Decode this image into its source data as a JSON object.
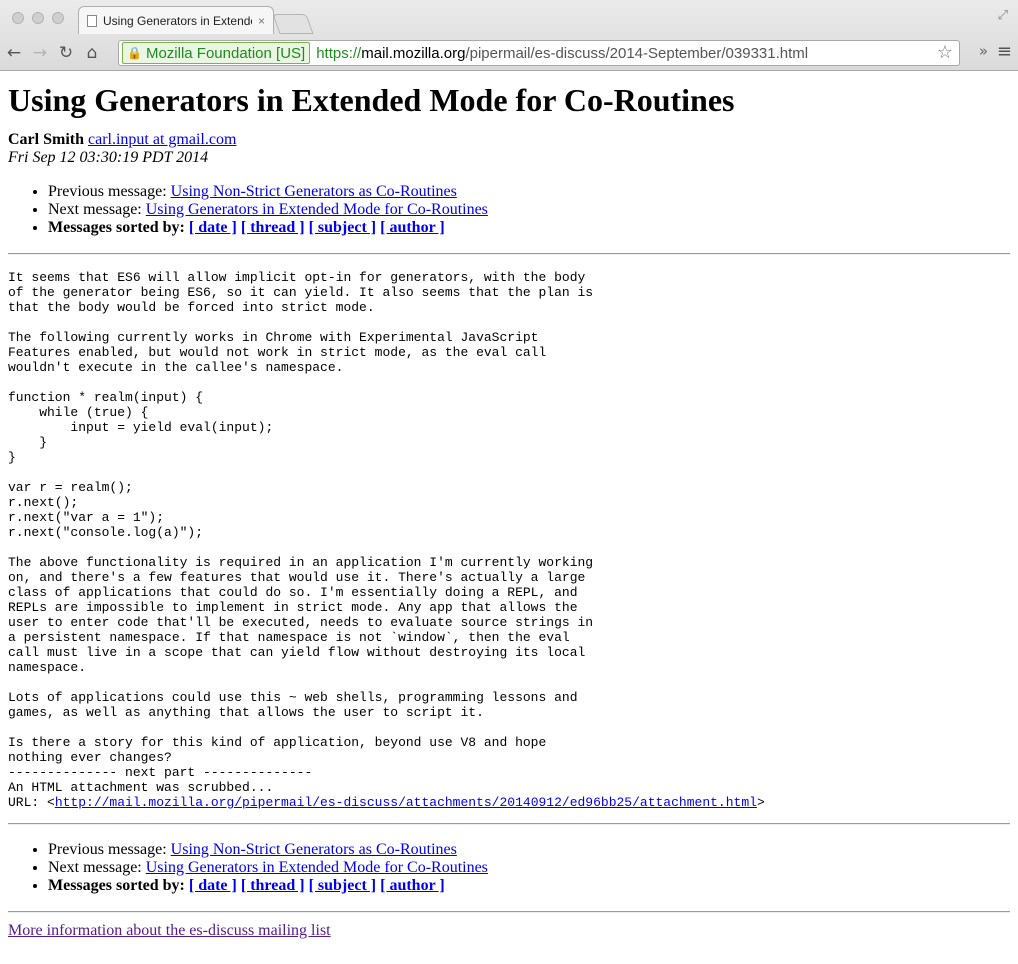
{
  "browser": {
    "tab_title": "Using Generators in Extende",
    "tab_close": "×",
    "ev_label": "Mozilla Foundation [US]",
    "url_scheme": "https://",
    "url_host": "mail.mozilla.org",
    "url_path": "/pipermail/es-discuss/2014-September/039331.html",
    "back": "←",
    "forward": "→",
    "reload": "↻",
    "home": "⌂",
    "star": "☆",
    "more": "»",
    "menu": "≡",
    "fullscreen": "⤢",
    "lock": "🔒"
  },
  "message": {
    "title": "Using Generators in Extended Mode for Co-Routines",
    "author": "Carl Smith",
    "email": "carl.input at gmail.com",
    "date": "Fri Sep 12 03:30:19 PDT 2014",
    "body": "It seems that ES6 will allow implicit opt-in for generators, with the body\nof the generator being ES6, so it can yield. It also seems that the plan is\nthat the body would be forced into strict mode.\n\nThe following currently works in Chrome with Experimental JavaScript\nFeatures enabled, but would not work in strict mode, as the eval call\nwouldn't execute in the callee's namespace.\n\nfunction * realm(input) {\n    while (true) {\n        input = yield eval(input);\n    }\n}\n\nvar r = realm();\nr.next();\nr.next(\"var a = 1\");\nr.next(\"console.log(a)\");\n\nThe above functionality is required in an application I'm currently working\non, and there's a few features that would use it. There's actually a large\nclass of applications that could do so. I'm essentially doing a REPL, and\nREPLs are impossible to implement in strict mode. Any app that allows the\nuser to enter code that'll be executed, needs to evaluate source strings in\na persistent namespace. If that namespace is not `window`, then the eval\ncall must live in a scope that can yield flow without destroying its local\nnamespace.\n\nLots of applications could use this ~ web shells, programming lessons and\ngames, as well as anything that allows the user to script it.\n\nIs there a story for this kind of application, beyond use V8 and hope\nnothing ever changes?\n-------------- next part --------------\nAn HTML attachment was scrubbed...",
    "attachment_prefix": "URL: <",
    "attachment_url": "http://mail.mozilla.org/pipermail/es-discuss/attachments/20140912/ed96bb25/attachment.html",
    "attachment_suffix": ">"
  },
  "nav": {
    "prev_label": "Previous message: ",
    "prev_link": "Using Non-Strict Generators as Co-Routines",
    "next_label": "Next message: ",
    "next_link": "Using Generators in Extended Mode for Co-Routines",
    "sorted_label": "Messages sorted by: ",
    "sort_date": "[ date ]",
    "sort_thread": "[ thread ]",
    "sort_subject": "[ subject ]",
    "sort_author": "[ author ]"
  },
  "footer": {
    "info_link": "More information about the es-discuss mailing list"
  }
}
